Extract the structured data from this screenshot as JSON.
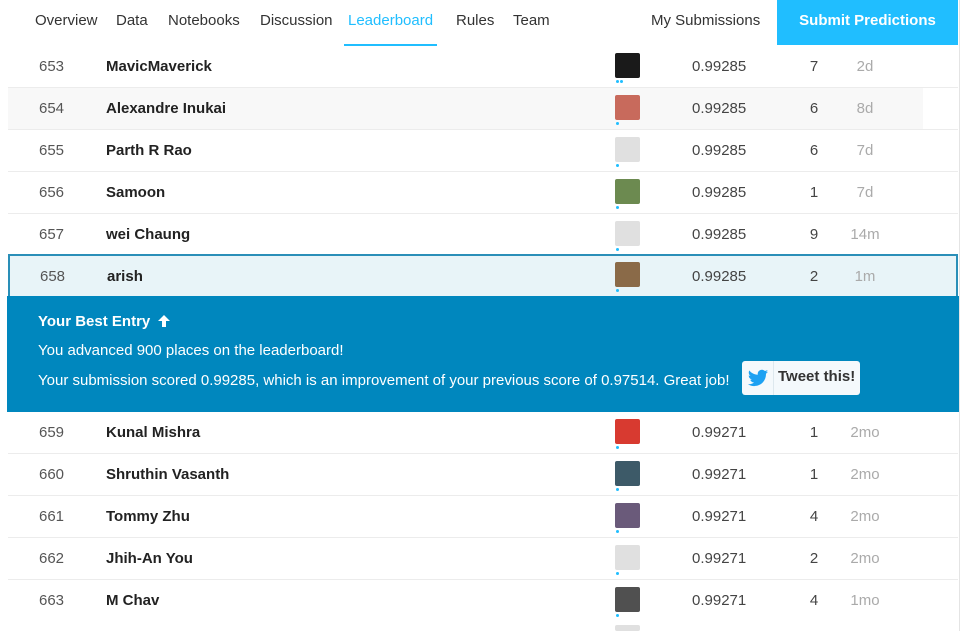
{
  "nav": {
    "tabs": [
      {
        "label": "Overview",
        "active": false
      },
      {
        "label": "Data",
        "active": false
      },
      {
        "label": "Notebooks",
        "active": false
      },
      {
        "label": "Discussion",
        "active": false
      },
      {
        "label": "Leaderboard",
        "active": true
      },
      {
        "label": "Rules",
        "active": false
      },
      {
        "label": "Team",
        "active": false
      }
    ],
    "my_submissions": "My Submissions",
    "submit_predictions": "Submit Predictions"
  },
  "rows_top": [
    {
      "rank": "653",
      "name": "MavicMaverick",
      "score": "0.99285",
      "entries": "7",
      "last": "2d",
      "avatar_color": "#1a1a1a",
      "dots": 2
    },
    {
      "rank": "654",
      "name": "Alexandre Inukai",
      "score": "0.99285",
      "entries": "6",
      "last": "8d",
      "avatar_color": "#c86a5c",
      "dots": 1
    },
    {
      "rank": "655",
      "name": "Parth R Rao",
      "score": "0.99285",
      "entries": "6",
      "last": "7d",
      "avatar_color": "#e0e0e0",
      "dots": 1
    },
    {
      "rank": "656",
      "name": "Samoon",
      "score": "0.99285",
      "entries": "1",
      "last": "7d",
      "avatar_color": "#6c8a50",
      "dots": 1
    },
    {
      "rank": "657",
      "name": "wei Chaung",
      "score": "0.99285",
      "entries": "9",
      "last": "14m",
      "avatar_color": "#e0e0e0",
      "dots": 1
    }
  ],
  "user_row": {
    "rank": "658",
    "name": "arish",
    "score": "0.99285",
    "entries": "2",
    "last": "1m",
    "avatar_color": "#8a6a48",
    "dots": 1
  },
  "banner": {
    "title": "Your Best Entry",
    "arrow": "🡅",
    "line1": "You advanced 900 places on the leaderboard!",
    "line2": "Your submission scored 0.99285, which is an improvement of your previous score of 0.97514. Great job!",
    "tweet_label": "Tweet this!"
  },
  "rows_bottom": [
    {
      "rank": "659",
      "name": "Kunal Mishra",
      "score": "0.99271",
      "entries": "1",
      "last": "2mo",
      "avatar_color": "#d83a30",
      "dots": 1
    },
    {
      "rank": "660",
      "name": "Shruthin Vasanth",
      "score": "0.99271",
      "entries": "1",
      "last": "2mo",
      "avatar_color": "#3d5a68",
      "dots": 1
    },
    {
      "rank": "661",
      "name": "Tommy Zhu",
      "score": "0.99271",
      "entries": "4",
      "last": "2mo",
      "avatar_color": "#6a5a7a",
      "dots": 1
    },
    {
      "rank": "662",
      "name": "Jhih-An You",
      "score": "0.99271",
      "entries": "2",
      "last": "2mo",
      "avatar_color": "#e0e0e0",
      "dots": 1
    },
    {
      "rank": "663",
      "name": "M Chav",
      "score": "0.99271",
      "entries": "4",
      "last": "1mo",
      "avatar_color": "#505050",
      "dots": 1
    }
  ],
  "colors": {
    "accent": "#20beff",
    "banner": "#0087be",
    "highlight_border": "#2a8fb8"
  }
}
